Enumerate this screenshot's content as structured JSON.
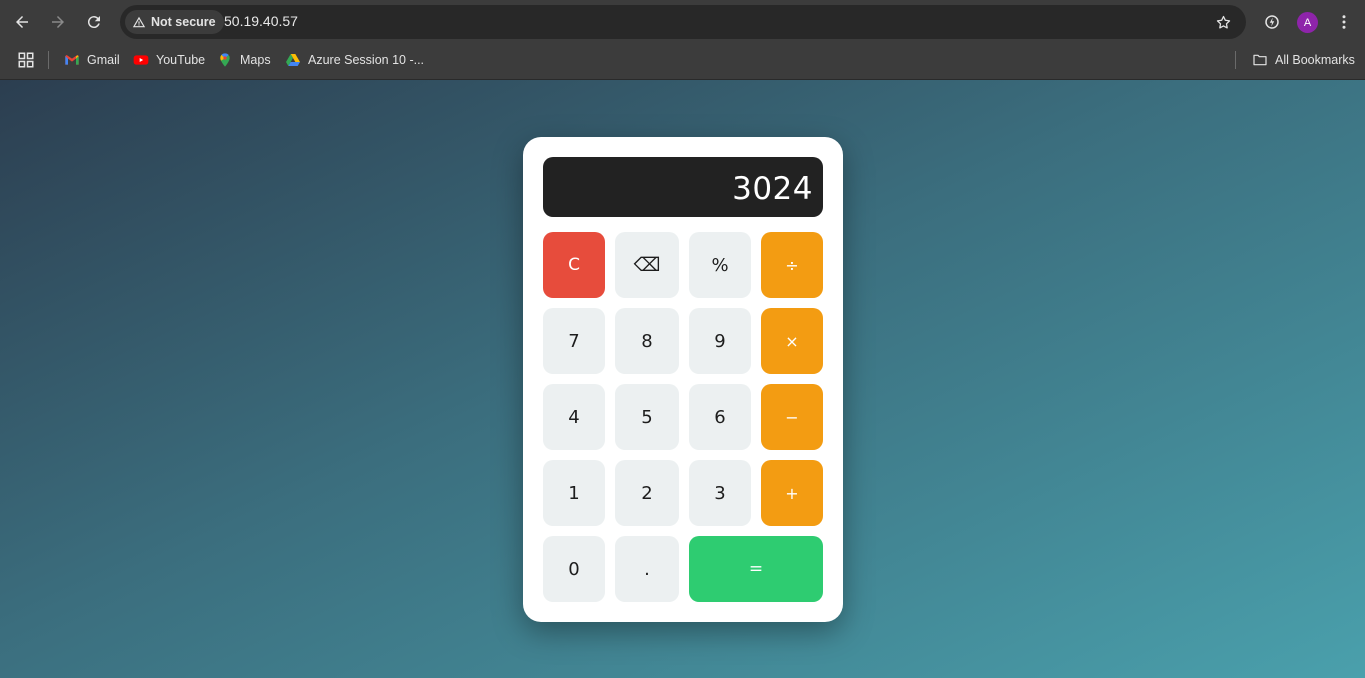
{
  "browser": {
    "url": "50.19.40.57",
    "security_label": "Not secure",
    "profile_initial": "A",
    "bookmarks": [
      {
        "label": "Gmail",
        "icon": "gmail-icon"
      },
      {
        "label": "YouTube",
        "icon": "youtube-icon"
      },
      {
        "label": "Maps",
        "icon": "maps-icon"
      },
      {
        "label": "Azure Session 10 -...",
        "icon": "drive-icon"
      }
    ],
    "all_bookmarks_label": "All Bookmarks"
  },
  "calculator": {
    "display_value": "3024",
    "keys": {
      "clear": "C",
      "backspace": "⌫",
      "percent": "%",
      "divide": "÷",
      "seven": "7",
      "eight": "8",
      "nine": "9",
      "multiply": "×",
      "four": "4",
      "five": "5",
      "six": "6",
      "subtract": "−",
      "one": "1",
      "two": "2",
      "three": "3",
      "add": "+",
      "zero": "0",
      "decimal": ".",
      "equals": "="
    },
    "colors": {
      "clear": "#e74c3c",
      "operator": "#f39c12",
      "equals": "#2ecc71",
      "digit": "#ecf0f1",
      "display": "#222222"
    }
  }
}
